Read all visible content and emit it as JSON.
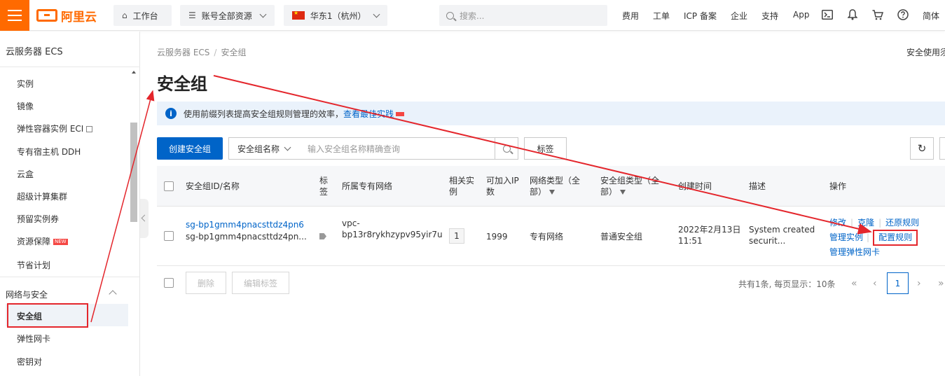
{
  "header": {
    "logo_text": "阿里云",
    "workbench_label": "工作台",
    "resources_label": "账号全部资源",
    "region_label": "华东1（杭州）",
    "search_placeholder": "搜索...",
    "nav_links": [
      "费用",
      "工单",
      "ICP 备案",
      "企业",
      "支持",
      "App"
    ],
    "language_label": "简体",
    "icons": [
      "terminal-icon",
      "bell-icon",
      "cart-icon",
      "help-icon"
    ]
  },
  "sidebar": {
    "title": "云服务器 ECS",
    "items": [
      {
        "label": "实例"
      },
      {
        "label": "镜像"
      },
      {
        "label": "弹性容器实例 ECI"
      },
      {
        "label": "专有宿主机 DDH"
      },
      {
        "label": "云盒"
      },
      {
        "label": "超级计算集群"
      },
      {
        "label": "预留实例券"
      },
      {
        "label": "资源保障",
        "badge": "NEW"
      },
      {
        "label": "节省计划"
      }
    ],
    "group_label": "网络与安全",
    "group_items": [
      {
        "label": "安全组",
        "active": true
      },
      {
        "label": "弹性网卡"
      },
      {
        "label": "密钥对"
      }
    ]
  },
  "breadcrumb": {
    "root": "云服务器 ECS",
    "separator": "/",
    "current": "安全组"
  },
  "top_right_link": "安全使用须",
  "page_title": "安全组",
  "notice": {
    "text": "使用前缀列表提高安全组规则管理的效率，",
    "link": "查看最佳实践"
  },
  "toolbar": {
    "create_label": "创建安全组",
    "filter_field": "安全组名称",
    "filter_placeholder": "输入安全组名称精确查询",
    "tag_label": "标签"
  },
  "table": {
    "columns": {
      "id_name": "安全组ID/名称",
      "tag_l1": "标",
      "tag_l2": "签",
      "vpc": "所属专有网络",
      "instances_l1": "相关实",
      "instances_l2": "例",
      "ip_l1": "可加入IP",
      "ip_l2": "数",
      "net_type_l1": "网络类型（全",
      "net_type_l2": "部）",
      "sg_type_l1": "安全组类型（全",
      "sg_type_l2": "部）",
      "created": "创建时间",
      "description": "描述",
      "actions": "操作"
    },
    "rows": [
      {
        "id": "sg-bp1gmm4pnacsttdz4pn6",
        "name": "sg-bp1gmm4pnacsttdz4pn...",
        "vpc_l1": "vpc-",
        "vpc_l2": "bp13r8rykhzypv95yir7u",
        "instances": "1",
        "ip_count": "1999",
        "net_type": "专有网络",
        "sg_type": "普通安全组",
        "created_l1": "2022年2月13日",
        "created_l2": "11:51",
        "desc_l1": "System created",
        "desc_l2": "securit...",
        "actions": {
          "modify": "修改",
          "clone": "克隆",
          "restore": "还原规则",
          "manage_instances": "管理实例",
          "configure_rules": "配置规则",
          "manage_eni": "管理弹性网卡"
        }
      }
    ]
  },
  "footer": {
    "delete_label": "删除",
    "edit_tags_label": "编辑标签",
    "total_text": "共有1条, 每页显示：10条",
    "current_page": "1",
    "pager_first": "«",
    "pager_prev": "‹",
    "pager_next": "›",
    "pager_last": "»"
  },
  "colors": {
    "brand": "#ff6a00",
    "primary": "#0064c8",
    "annotation": "#e4262c"
  }
}
